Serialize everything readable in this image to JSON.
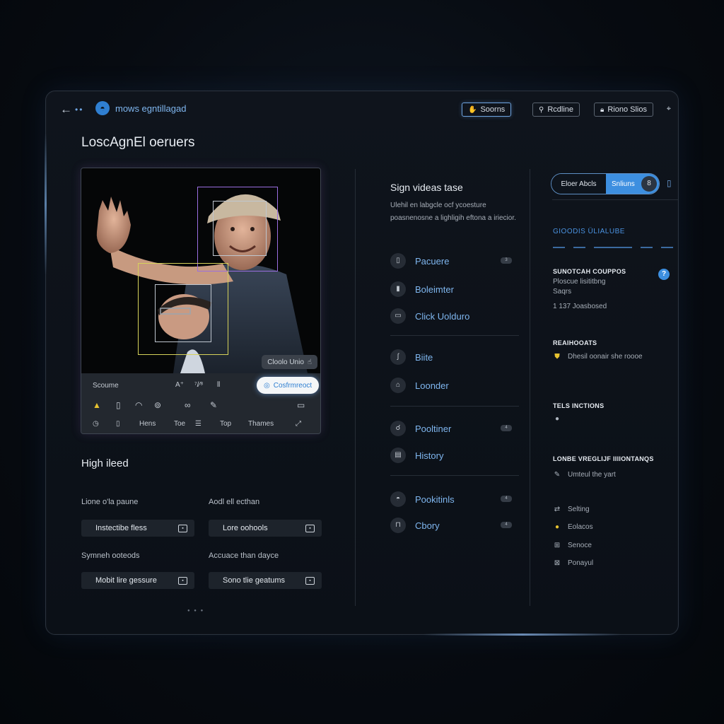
{
  "topbar": {
    "brand_name": "mows egntillagad",
    "btn_primary": "Soorns",
    "btn_secondary": "Rcdline",
    "btn_tertiary": "Riono Slios"
  },
  "page_title": "LoscAgnEl oeruers",
  "image_panel": {
    "photo_chip": "Cloolo Unio",
    "tools_label": "Scoume",
    "tool_a": "A⁺",
    "tool_b": "⁷/⁄⁸",
    "confirm_label": "Cosfrmreoct",
    "bottom_items": [
      "Hens",
      "Toe",
      "Top",
      "Thames"
    ]
  },
  "high_level": {
    "title": "High ileed",
    "fields": [
      {
        "label": "Lione o'la paune",
        "value": "Instectibe fless"
      },
      {
        "label": "Aodl ell ecthan",
        "value": "Lore oohools"
      },
      {
        "label": "Symneh ooteods",
        "value": "Mobit lire gessure"
      },
      {
        "label": "Accuace than dayce",
        "value": "Sono tlie geatums"
      }
    ]
  },
  "middle": {
    "title": "Sign videas tase",
    "description": "Ulehil en labgcle ocf ycoesture poasnenosne a lighligih eftona a iriecior.",
    "groups": [
      [
        {
          "label": "Pacuere",
          "icon": "device-icon",
          "glyph": "▯",
          "badge": "3"
        },
        {
          "label": "Boleimter",
          "icon": "pin-icon",
          "glyph": "▮"
        },
        {
          "label": "Click Uolduro",
          "icon": "box-icon",
          "glyph": "▭"
        }
      ],
      [
        {
          "label": "Biite",
          "icon": "stroke-icon",
          "glyph": "ʃ"
        },
        {
          "label": "Loonder",
          "icon": "folder-icon",
          "glyph": "⌂"
        }
      ],
      [
        {
          "label": "Pooltiner",
          "icon": "hand-icon",
          "glyph": "☌",
          "badge": "4"
        },
        {
          "label": "History",
          "icon": "history-icon",
          "glyph": "▤"
        }
      ],
      [
        {
          "label": "Pookitinls",
          "icon": "gesture-icon",
          "glyph": "◓",
          "badge": "4"
        },
        {
          "label": "Cbory",
          "icon": "bag-icon",
          "glyph": "⊓",
          "badge": "4"
        }
      ]
    ]
  },
  "right": {
    "seg_a": "Eloer Abcls",
    "seg_b": "Snliuns",
    "seg_count": "8",
    "blue_title": "GIOODIS ÜLIALUBE",
    "block1_title": "SUNOTCAH COUPPOS",
    "block1_lines": [
      "Ploscue lisititbng",
      "Saqrs"
    ],
    "block1_meta": "1 137 Joasbosed",
    "block2_title": "REAIHOOATS",
    "block2_line": "Dhesil oonair she roooe",
    "block3_title": "TELS INCTIONS",
    "block4_title": "LONBE VREGLIJF IIIIONTANQS",
    "block4_line": "Umteul the yart",
    "list": [
      {
        "label": "Selting",
        "icon": "settings-icon",
        "glyph": "⇄"
      },
      {
        "label": "Eolacos",
        "icon": "circle-icon",
        "glyph": "●"
      },
      {
        "label": "Senoce",
        "icon": "grid-icon",
        "glyph": "⊞"
      },
      {
        "label": "Ponayul",
        "icon": "image-icon",
        "glyph": "⊠"
      }
    ]
  }
}
